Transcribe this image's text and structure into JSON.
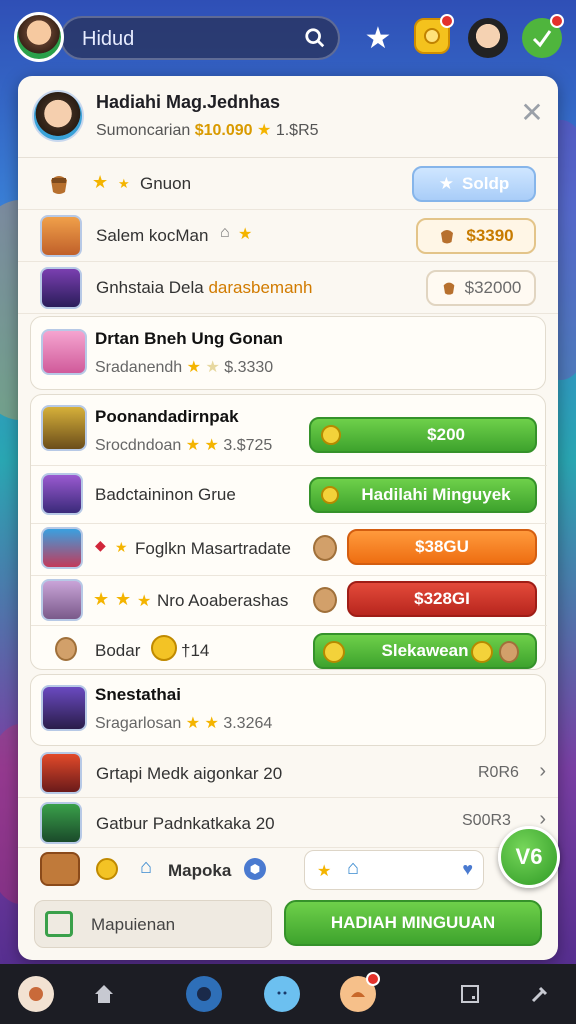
{
  "topbar": {
    "search_text": "Hidud"
  },
  "card": {
    "title": "Hadiahi Mag.Jednhas",
    "subtitle_prefix": "Sumoncarian",
    "subtitle_gold": "$10.090",
    "subtitle_suffix": "1.$R5",
    "filter_label": "Gnuon",
    "filter_button": "Soldp"
  },
  "rows": [
    {
      "label": "Salem kocMan",
      "price": "$3390"
    },
    {
      "label": "Gnhstaia Dela",
      "label_gold": "darasbemanh",
      "price": "$32000"
    }
  ],
  "featured1": {
    "title": "Drtan Bneh Ung Gonan",
    "sub": "Sradanendh",
    "value": "$.3330"
  },
  "featured2": {
    "title": "Poonandadirnpak",
    "sub": "Srocdndoan",
    "value": "3.$725",
    "price": "$200",
    "items": [
      {
        "label": "Badctaininon Grue",
        "button": "Hadilahi Minguyek"
      },
      {
        "label": "Foglkn Masartradate",
        "button": "$38GU"
      },
      {
        "label": "Nro Aoaberashas",
        "button": "$328GI"
      }
    ],
    "bonus_label": "Bodar",
    "bonus_value": "†14",
    "bonus_button": "Slekawean"
  },
  "featured3": {
    "title": "Snestathai",
    "sub": "Sragarlosan",
    "value": "3.3264"
  },
  "list": [
    {
      "label": "Grtapi Medk aigonkar 20",
      "value": "R0R6"
    },
    {
      "label": "Gatbur Padnkatkaka 20",
      "value": "S00R3"
    }
  ],
  "tray": {
    "label": "Mapoka"
  },
  "level": "V6",
  "footer": {
    "field_label": "Mapuienan",
    "button": "HADIAH MINGUUAN"
  }
}
